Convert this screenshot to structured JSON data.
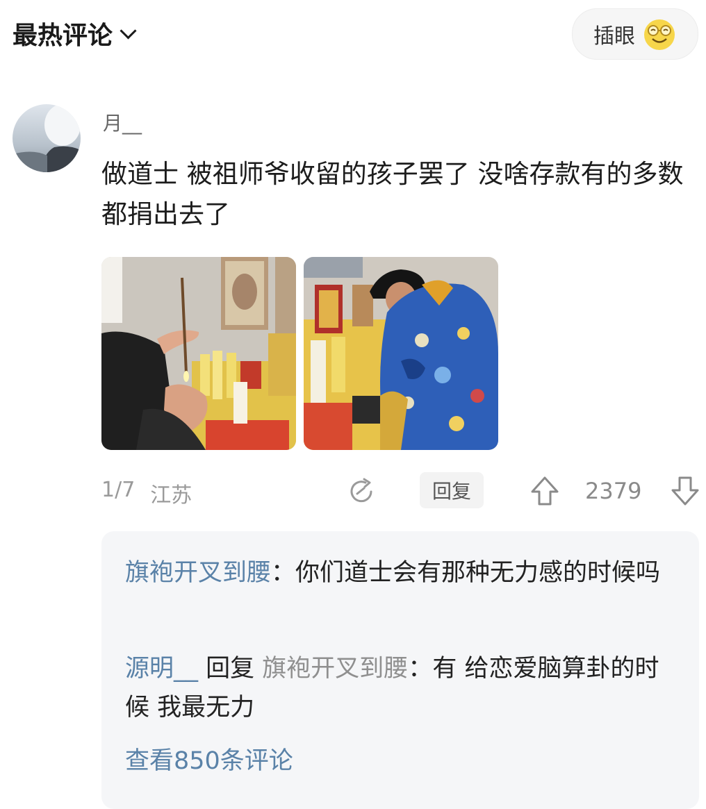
{
  "header": {
    "sort_label": "最热评论",
    "insert_label": "插眼"
  },
  "comment": {
    "username": "月__",
    "text": "做道士 被祖师爷收留的孩子罢了 没啥存款有的多数都捐出去了",
    "images": [
      "photo-incense",
      "photo-robed-priest"
    ],
    "meta": {
      "floor": "1/7",
      "location": "江苏"
    },
    "reply_button": "回复",
    "like_count": "2379"
  },
  "replies": [
    {
      "user": "旗袍开叉到腰",
      "separator": "：",
      "text": "你们道士会有那种无力感的时候吗"
    },
    {
      "user": "源明__",
      "reply_word": " 回复 ",
      "target": "旗袍开叉到腰",
      "separator": "：",
      "text": "有 给恋爱脑算卦的时候 我最无力"
    }
  ],
  "view_more": "查看850条评论",
  "colors": {
    "link_blue": "#5a82a8",
    "meta_gray": "#9a9a9a",
    "reply_bg": "#f5f6f8"
  },
  "icons": [
    "chevron-down-icon",
    "smile-glasses-icon",
    "share-icon",
    "thumb-up-icon",
    "thumb-down-icon"
  ]
}
